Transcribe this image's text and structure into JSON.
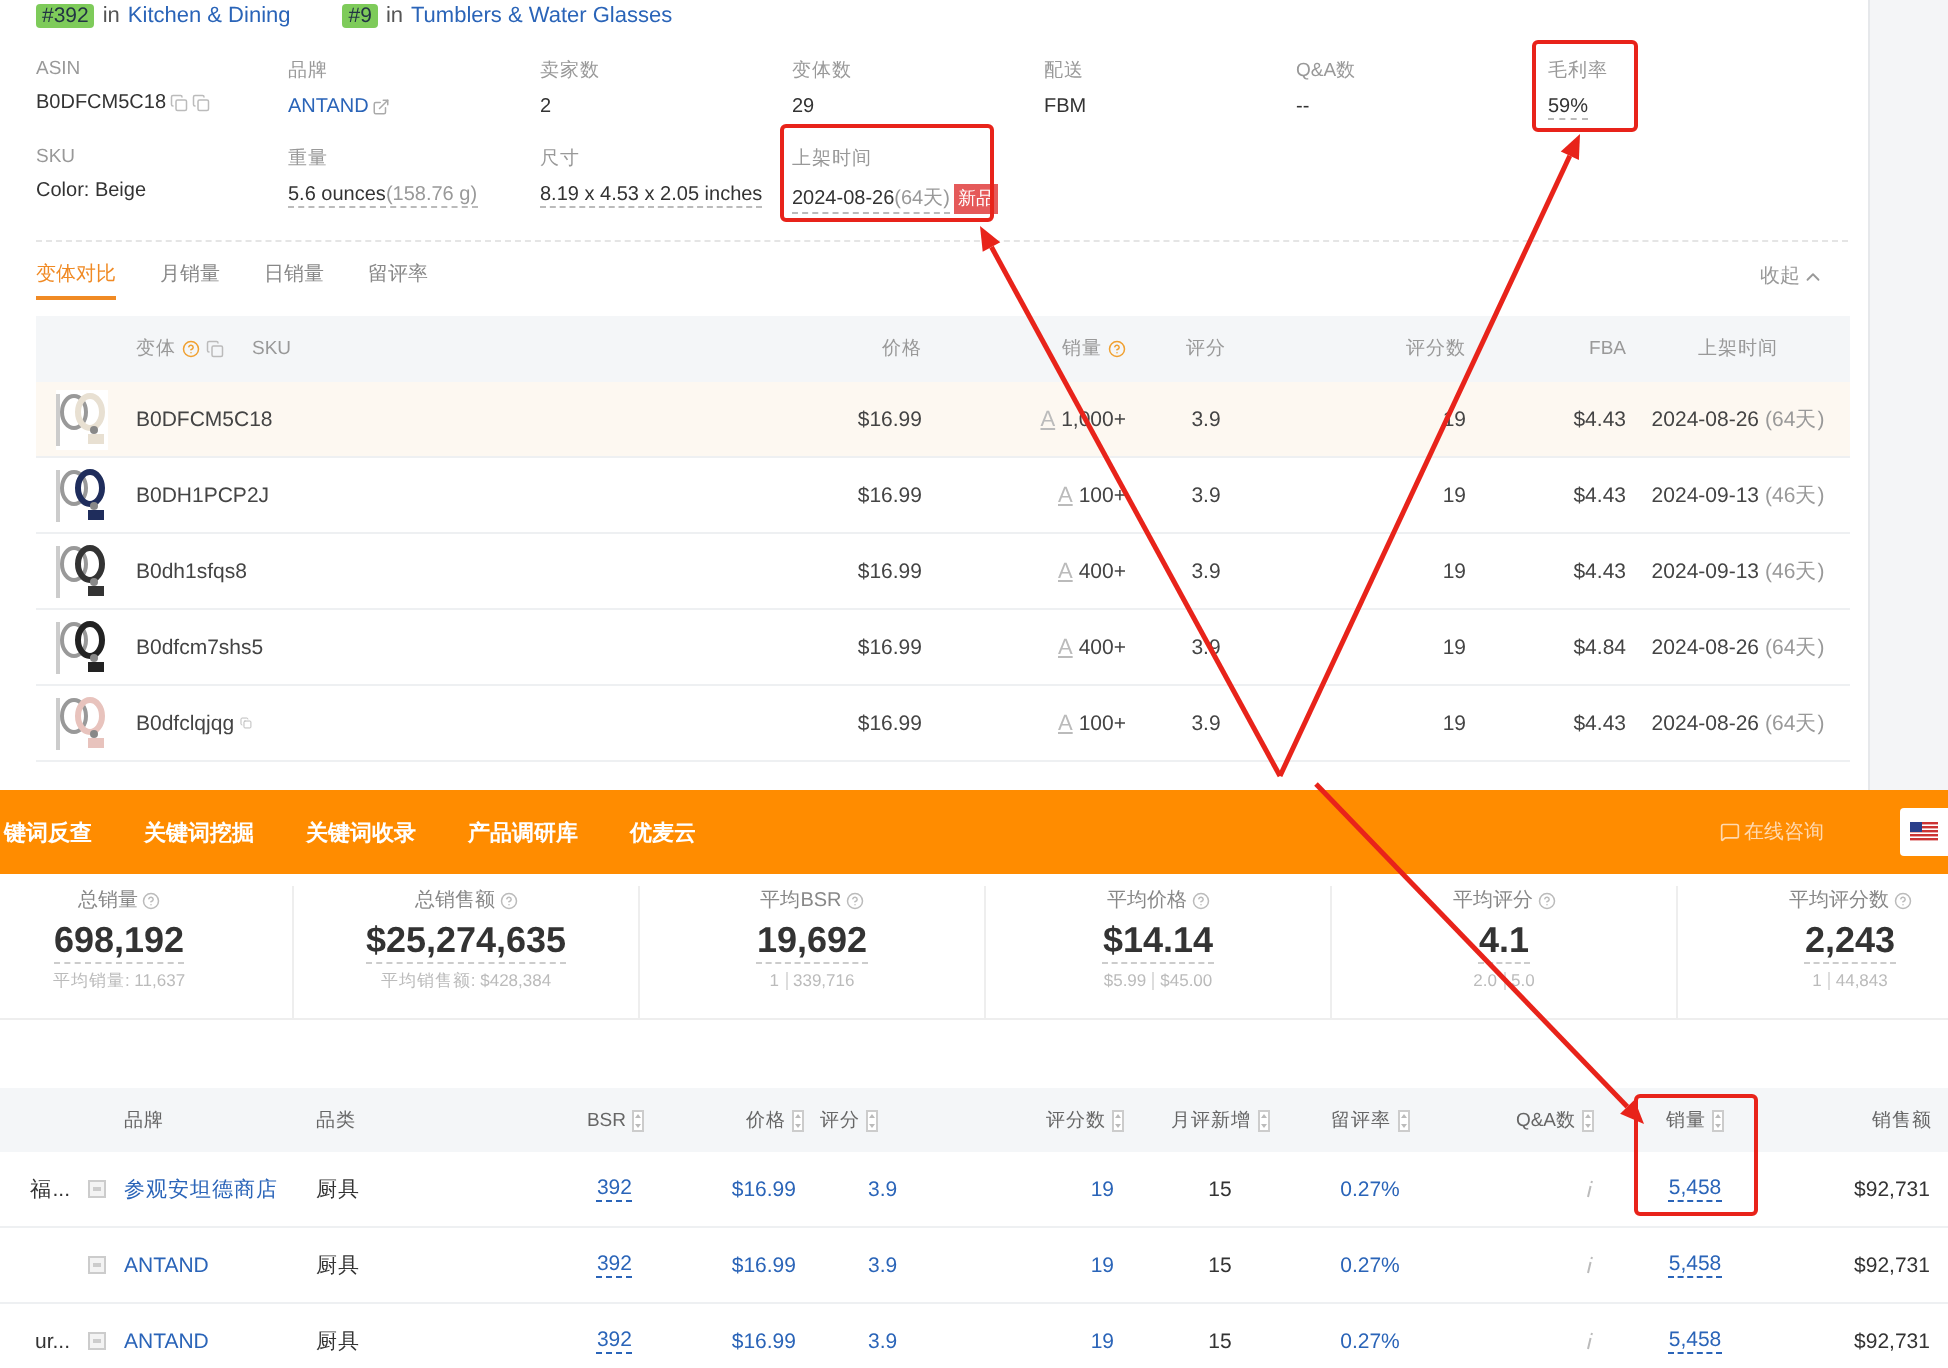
{
  "rank_badges": [
    {
      "rank": "#392",
      "joiner": "in",
      "category": "Kitchen & Dining"
    },
    {
      "rank": "#9",
      "joiner": "in",
      "category": "Tumblers & Water Glasses"
    }
  ],
  "info_rows": [
    [
      {
        "label": "ASIN",
        "value": "B0DFCM5C18",
        "kind": "copy"
      },
      {
        "label": "品牌",
        "value": "ANTAND",
        "kind": "link"
      },
      {
        "label": "卖家数",
        "value": "2",
        "kind": "plain"
      },
      {
        "label": "变体数",
        "value": "29",
        "kind": "plain"
      },
      {
        "label": "配送",
        "value": "FBM",
        "kind": "plain"
      },
      {
        "label": "Q&A数",
        "value": "--",
        "kind": "plain"
      },
      {
        "label": "毛利率",
        "value": "59%",
        "kind": "dashed"
      }
    ],
    [
      {
        "label": "SKU",
        "value": "Color: Beige",
        "kind": "plain"
      },
      {
        "label": "重量",
        "value": "5.6 ounces",
        "note": "(158.76 g)",
        "kind": "dashed"
      },
      {
        "label": "尺寸",
        "value": "8.19 x 4.53 x 2.05 inches",
        "kind": "dashed"
      },
      {
        "label": "上架时间",
        "value": "2024-08-26",
        "note": "(64天)",
        "badge": "新品",
        "kind": "dashed"
      }
    ]
  ],
  "tabs": [
    {
      "label": "变体对比",
      "selected": true
    },
    {
      "label": "月销量",
      "selected": false
    },
    {
      "label": "日销量",
      "selected": false
    },
    {
      "label": "留评率",
      "selected": false
    }
  ],
  "collapse": "收起",
  "variant_columns": [
    {
      "label": "变体",
      "help": true,
      "copy": true
    },
    {
      "label": "SKU",
      "help": false,
      "copy": false
    },
    {
      "label": "价格",
      "help": false,
      "copy": false
    },
    {
      "label": "销量",
      "help": true,
      "copy": false
    },
    {
      "label": "评分",
      "help": false,
      "copy": false
    },
    {
      "label": "评分数",
      "help": false,
      "copy": false
    },
    {
      "label": "FBA",
      "help": false,
      "copy": false
    },
    {
      "label": "上架时间",
      "help": false,
      "copy": false
    }
  ],
  "variants": [
    {
      "asin": "B0DFCM5C18",
      "price": "$16.99",
      "mark": "A",
      "sales": "1,000+",
      "rating": "3.9",
      "rating_count": "19",
      "fba": "$4.43",
      "date": "2024-08-26",
      "days": "(64天)",
      "selected": true
    },
    {
      "asin": "B0DH1PCP2J",
      "price": "$16.99",
      "mark": "A",
      "sales": "100+",
      "rating": "3.9",
      "rating_count": "19",
      "fba": "$4.43",
      "date": "2024-09-13",
      "days": "(46天)",
      "selected": false
    },
    {
      "asin": "B0dh1sfqs8",
      "price": "$16.99",
      "mark": "A",
      "sales": "400+",
      "rating": "3.9",
      "rating_count": "19",
      "fba": "$4.43",
      "date": "2024-09-13",
      "days": "(46天)",
      "selected": false
    },
    {
      "asin": "B0dfcm7shs5",
      "price": "$16.99",
      "mark": "A",
      "sales": "400+",
      "rating": "3.9",
      "rating_count": "19",
      "fba": "$4.84",
      "date": "2024-08-26",
      "days": "(64天)",
      "selected": false
    },
    {
      "asin": "B0dfclqjqg",
      "price": "$16.99",
      "mark": "A",
      "sales": "100+",
      "rating": "3.9",
      "rating_count": "19",
      "fba": "$4.43",
      "date": "2024-08-26",
      "days": "(64天)",
      "selected": false
    }
  ],
  "nav": {
    "items": [
      "键词反查",
      "关键词挖掘",
      "关键词收录",
      "产品调研库",
      "优麦云"
    ],
    "consult": "在线咨询"
  },
  "stats": [
    {
      "label": "总销量",
      "value": "698,192",
      "sub": [
        "平均销量: 11,637"
      ]
    },
    {
      "label": "总销售额",
      "value": "$25,274,635",
      "sub": [
        "平均销售额: $428,384"
      ]
    },
    {
      "label": "平均BSR",
      "value": "19,692",
      "sub": [
        "1",
        "339,716"
      ]
    },
    {
      "label": "平均价格",
      "value": "$14.14",
      "sub": [
        "$5.99",
        "$45.00"
      ]
    },
    {
      "label": "平均评分",
      "value": "4.1",
      "sub": [
        "2.0",
        "5.0"
      ]
    },
    {
      "label": "平均评分数",
      "value": "2,243",
      "sub": [
        "1",
        "44,843"
      ]
    }
  ],
  "product_columns": [
    {
      "label": "品牌",
      "sortable": false
    },
    {
      "label": "品类",
      "sortable": false
    },
    {
      "label": "BSR",
      "sortable": true
    },
    {
      "label": "价格",
      "sortable": true
    },
    {
      "label": "评分",
      "sortable": true
    },
    {
      "label": "评分数",
      "sortable": true
    },
    {
      "label": "月评新增",
      "sortable": true
    },
    {
      "label": "留评率",
      "sortable": true
    },
    {
      "label": "Q&A数",
      "sortable": true
    },
    {
      "label": "销量",
      "sortable": true
    },
    {
      "label": "销售额",
      "sortable": false
    }
  ],
  "products": [
    {
      "title": "福...",
      "brand": "参观安坦德商店",
      "category": "厨具",
      "bsr": "392",
      "price": "$16.99",
      "rating": "3.9",
      "rating_count": "19",
      "monthly_new": "15",
      "review_rate": "0.27%",
      "sales": "5,458",
      "revenue": "$92,731"
    },
    {
      "brand": "ANTAND",
      "category": "厨具",
      "bsr": "392",
      "price": "$16.99",
      "rating": "3.9",
      "rating_count": "19",
      "monthly_new": "15",
      "review_rate": "0.27%",
      "sales": "5,458",
      "revenue": "$92,731"
    },
    {
      "title": "ur...",
      "brand": "ANTAND",
      "category": "厨具",
      "bsr": "392",
      "price": "$16.99",
      "rating": "3.9",
      "rating_count": "19",
      "monthly_new": "15",
      "review_rate": "0.27%",
      "sales": "5,458",
      "revenue": "$92,731"
    }
  ]
}
